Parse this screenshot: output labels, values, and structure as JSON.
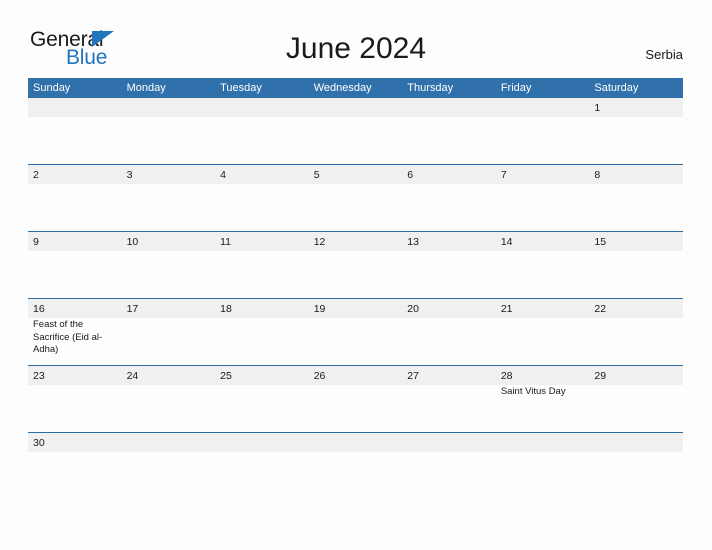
{
  "brand": {
    "name_top": "General",
    "name_bottom": "Blue",
    "accent_color": "#2175bd"
  },
  "header": {
    "title": "June 2024",
    "region": "Serbia"
  },
  "theme": {
    "header_band": "#3071ab",
    "rule_line": "#2e6da4",
    "week_band": "#f0f0f0",
    "page_background": "#fdfdfd",
    "text": "#1a1a1a"
  },
  "calendar": {
    "month": "June",
    "year": "2024",
    "day_headers": [
      "Sunday",
      "Monday",
      "Tuesday",
      "Wednesday",
      "Thursday",
      "Friday",
      "Saturday"
    ],
    "weeks": [
      {
        "days": [
          {
            "number": "",
            "event": ""
          },
          {
            "number": "",
            "event": ""
          },
          {
            "number": "",
            "event": ""
          },
          {
            "number": "",
            "event": ""
          },
          {
            "number": "",
            "event": ""
          },
          {
            "number": "",
            "event": ""
          },
          {
            "number": "1",
            "event": ""
          }
        ]
      },
      {
        "days": [
          {
            "number": "2",
            "event": ""
          },
          {
            "number": "3",
            "event": ""
          },
          {
            "number": "4",
            "event": ""
          },
          {
            "number": "5",
            "event": ""
          },
          {
            "number": "6",
            "event": ""
          },
          {
            "number": "7",
            "event": ""
          },
          {
            "number": "8",
            "event": ""
          }
        ]
      },
      {
        "days": [
          {
            "number": "9",
            "event": ""
          },
          {
            "number": "10",
            "event": ""
          },
          {
            "number": "11",
            "event": ""
          },
          {
            "number": "12",
            "event": ""
          },
          {
            "number": "13",
            "event": ""
          },
          {
            "number": "14",
            "event": ""
          },
          {
            "number": "15",
            "event": ""
          }
        ]
      },
      {
        "days": [
          {
            "number": "16",
            "event": "Feast of the Sacrifice (Eid al-Adha)"
          },
          {
            "number": "17",
            "event": ""
          },
          {
            "number": "18",
            "event": ""
          },
          {
            "number": "19",
            "event": ""
          },
          {
            "number": "20",
            "event": ""
          },
          {
            "number": "21",
            "event": ""
          },
          {
            "number": "22",
            "event": ""
          }
        ]
      },
      {
        "days": [
          {
            "number": "23",
            "event": ""
          },
          {
            "number": "24",
            "event": ""
          },
          {
            "number": "25",
            "event": ""
          },
          {
            "number": "26",
            "event": ""
          },
          {
            "number": "27",
            "event": ""
          },
          {
            "number": "28",
            "event": "Saint Vitus Day"
          },
          {
            "number": "29",
            "event": ""
          }
        ]
      },
      {
        "days": [
          {
            "number": "30",
            "event": ""
          },
          {
            "number": "",
            "event": ""
          },
          {
            "number": "",
            "event": ""
          },
          {
            "number": "",
            "event": ""
          },
          {
            "number": "",
            "event": ""
          },
          {
            "number": "",
            "event": ""
          },
          {
            "number": "",
            "event": ""
          }
        ]
      }
    ]
  }
}
